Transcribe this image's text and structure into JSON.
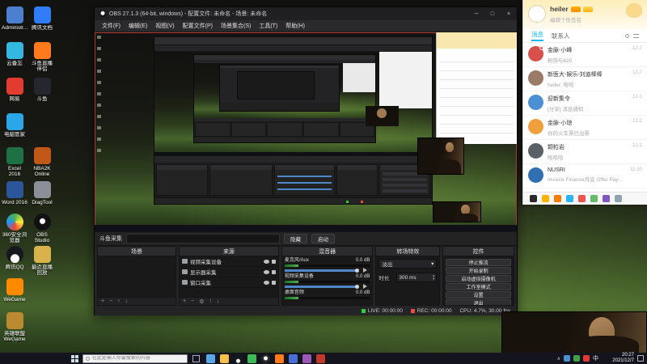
{
  "icons": {
    "minimize": "─",
    "maximize": "□",
    "close": "×",
    "caret_down": "▾",
    "spin_up": "▴",
    "spin_down": "▾",
    "plus": "+",
    "minus": "−",
    "arrow_up": "↑",
    "arrow_down": "↓",
    "gear": "⚙",
    "tray_up": "∧"
  },
  "desktop": {
    "icons": [
      {
        "label": "Administr..."
      },
      {
        "label": "腾讯文档"
      },
      {
        "label": "云备忘"
      },
      {
        "label": "斗鱼直播伴侣"
      },
      {
        "label": "网易"
      },
      {
        "label": "斗鱼"
      },
      {
        "label": "电脑管家"
      },
      {
        "label": "Excel 2016"
      },
      {
        "label": "NBA2K Online"
      },
      {
        "label": "Word 2016"
      },
      {
        "label": "DiagTool"
      },
      {
        "label": "360安全浏览器"
      },
      {
        "label": "OBS Studio"
      },
      {
        "label": "腾讯QQ"
      },
      {
        "label": "最近直播回放"
      },
      {
        "label": "WeGame"
      },
      {
        "label": "英雄联盟WeGame版"
      }
    ]
  },
  "obs": {
    "title": "OBS 27.1.3 (64-bit, windows) - 配置文件: 未命名 - 场景: 未命名",
    "menus": [
      {
        "label": "文件(F)"
      },
      {
        "label": "编辑(E)"
      },
      {
        "label": "视图(V)"
      },
      {
        "label": "配置文件(P)"
      },
      {
        "label": "场景集合(S)"
      },
      {
        "label": "工具(T)"
      },
      {
        "label": "帮助(H)"
      }
    ],
    "dock_strip": {
      "label": "斗鱼采集",
      "hide_button": "隐藏",
      "start_button": "启动"
    },
    "scenes": {
      "title": "场景"
    },
    "sources": {
      "title": "来源",
      "items": [
        {
          "name": "视频采集设备"
        },
        {
          "name": "显示器采集"
        },
        {
          "name": "窗口采集"
        }
      ]
    },
    "mixer": {
      "title": "混音器",
      "channels": [
        {
          "name": "麦克风/Aux",
          "level": "0.0 dB"
        },
        {
          "name": "视频采集设备",
          "level": "0.0 dB"
        },
        {
          "name": "桌面音频",
          "level": "0.0 dB"
        }
      ]
    },
    "transitions": {
      "title": "转场特效",
      "selected": "淡出",
      "duration_label": "时长",
      "duration_value": "300 ms"
    },
    "controls": {
      "title": "控件",
      "buttons": [
        {
          "label": "停止推流"
        },
        {
          "label": "开始录制"
        },
        {
          "label": "启动虚拟摄像机"
        },
        {
          "label": "工作室模式"
        },
        {
          "label": "设置"
        },
        {
          "label": "退出"
        }
      ]
    },
    "status": {
      "live": "LIVE: 00:00:00",
      "rec": "REC: 00:00:00",
      "stats": "CPU: 4.7%, 30.00 fps"
    }
  },
  "qq": {
    "name": "heiler",
    "signature": "编辑个性签名",
    "tabs": [
      {
        "label": "消息"
      },
      {
        "label": "联系人"
      }
    ],
    "chats": [
      {
        "name": "金脉-小峰",
        "msg": "粉饰与625",
        "time": "12-7"
      },
      {
        "name": "新医大-娱乐-刘迪棒棒",
        "msg": "heiler: 哈哈",
        "time": "12-7"
      },
      {
        "name": "迎新集令",
        "msg": "[分享] 消息通知",
        "time": "12-1"
      },
      {
        "name": "金脉-小琼",
        "msg": "你的火车票已出票",
        "time": "12-2"
      },
      {
        "name": "颗粒岩",
        "msg": "哈哈哈",
        "time": "12-1"
      },
      {
        "name": "NUSRI",
        "msg": "Invoice Finance月底 Offer Pay…",
        "time": "11-30"
      }
    ]
  },
  "taskbar": {
    "search_placeholder": "在此处输入你要搜索的内容",
    "lang": "中",
    "time": "20:27",
    "date": "2021/12/7"
  }
}
